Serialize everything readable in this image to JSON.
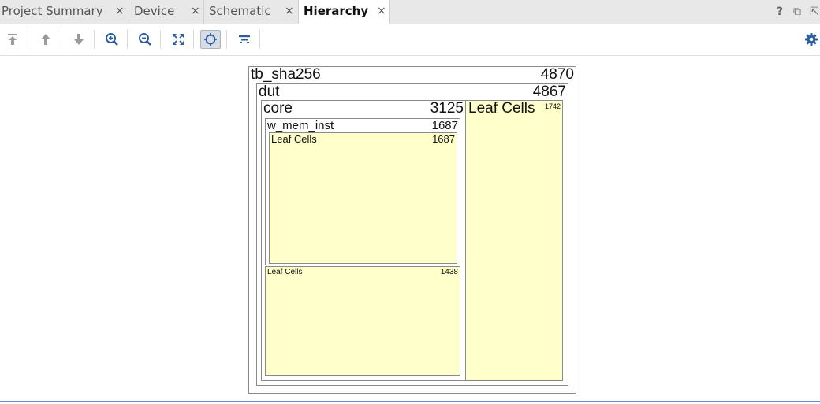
{
  "tabs": [
    {
      "label": "Project Summary",
      "close": "×",
      "active": false
    },
    {
      "label": "Device",
      "close": "×",
      "active": false
    },
    {
      "label": "Schematic",
      "close": "×",
      "active": false
    },
    {
      "label": "Hierarchy",
      "close": "×",
      "active": true
    }
  ],
  "window_controls": {
    "help": "?",
    "restore": "⧉",
    "float": "⇱"
  },
  "toolbar_icons": [
    "move-to-top-icon",
    "move-up-icon",
    "move-down-icon",
    "zoom-in-icon",
    "zoom-out-icon",
    "fit-to-view-icon",
    "crosshair-icon",
    "layout-icon",
    "settings-gear-icon"
  ],
  "hierarchy": {
    "root": {
      "name": "tb_sha256",
      "count": "4870"
    },
    "dut": {
      "name": "dut",
      "count": "4867"
    },
    "core": {
      "name": "core",
      "count": "3125"
    },
    "w_mem_inst": {
      "name": "w_mem_inst",
      "count": "1687"
    },
    "w_mem_leaf": {
      "name": "Leaf Cells",
      "count": "1687"
    },
    "core_leaf": {
      "name": "Leaf Cells",
      "count": "1438"
    },
    "dut_leaf": {
      "name": "Leaf Cells",
      "count": "1742"
    }
  },
  "colors": {
    "leaf_fill": "#ffffcc",
    "accent_line": "#5b8ed0",
    "icon_gray": "#9a9a9a",
    "icon_blue": "#2a5d9f"
  }
}
